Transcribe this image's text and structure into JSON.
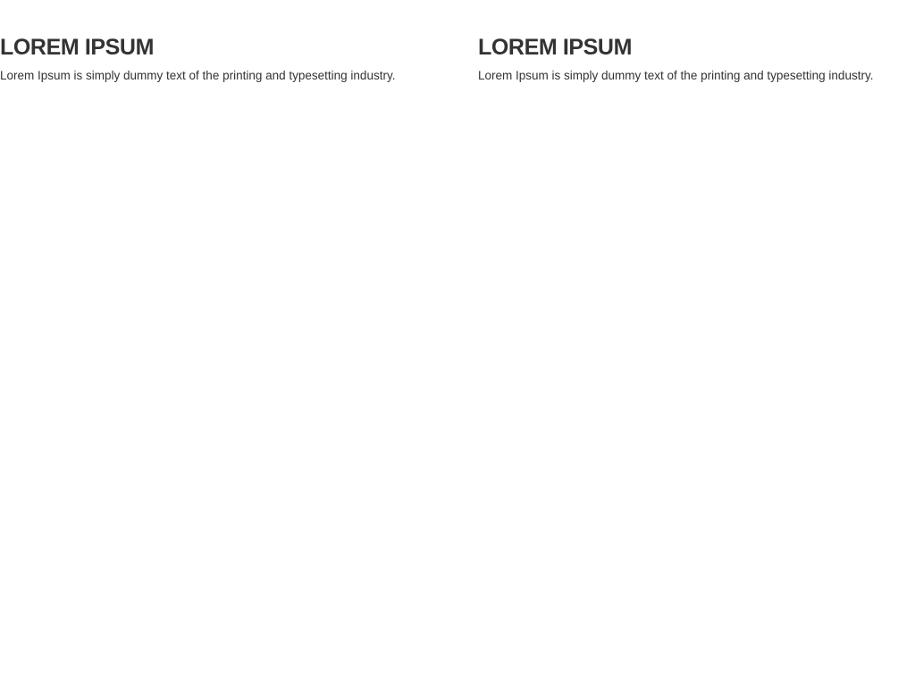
{
  "columns": [
    {
      "heading": "LOREM IPSUM",
      "text": "Lorem Ipsum is simply dummy text of the printing and typesetting industry."
    },
    {
      "heading": "LOREM IPSUM",
      "text": "Lorem Ipsum is simply dummy text of the printing and typesetting industry."
    }
  ],
  "colors": {
    "text": "#333333",
    "background": "#ffffff"
  }
}
